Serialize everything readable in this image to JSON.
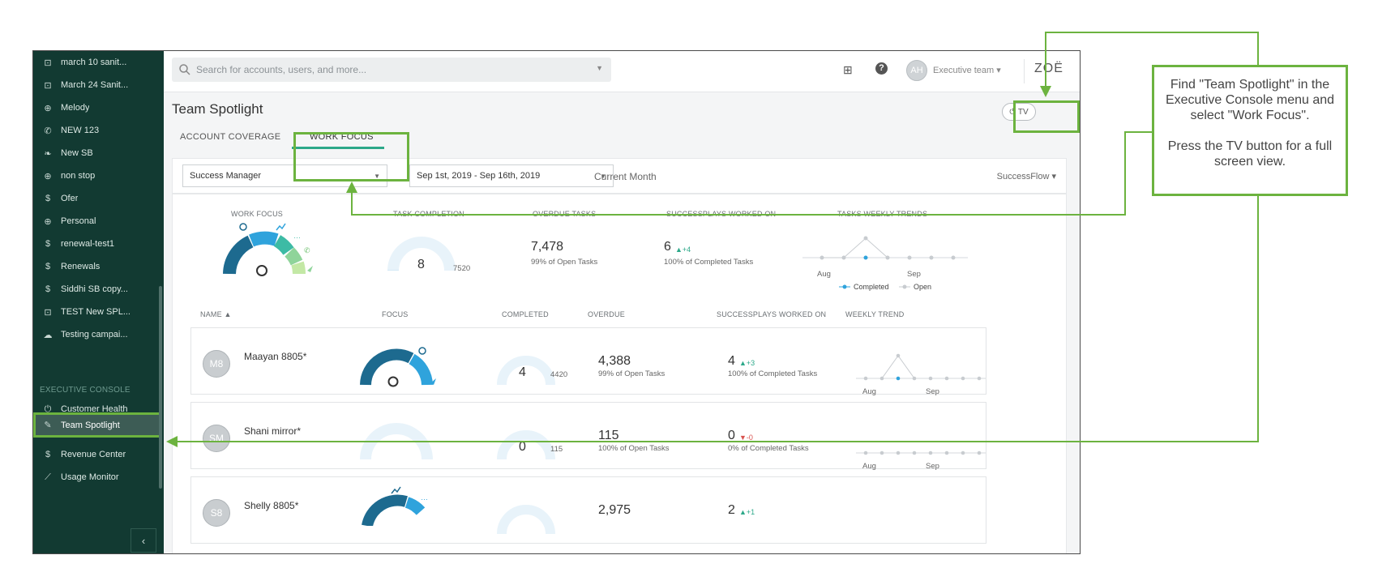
{
  "sidebar": {
    "items": [
      {
        "label": "march 10 sanit...",
        "icon": "shield-dollar-icon",
        "glyph": "⊡"
      },
      {
        "label": "March 24 Sanit...",
        "icon": "shield-dollar-icon",
        "glyph": "⊡"
      },
      {
        "label": "Melody",
        "icon": "lifebuoy-icon",
        "glyph": "⊕"
      },
      {
        "label": "NEW 123",
        "icon": "phone-icon",
        "glyph": "✆"
      },
      {
        "label": "New SB",
        "icon": "leaf-icon",
        "glyph": "❧"
      },
      {
        "label": "non stop",
        "icon": "lifebuoy-icon",
        "glyph": "⊕"
      },
      {
        "label": "Ofer",
        "icon": "dollar-icon",
        "glyph": "$"
      },
      {
        "label": "Personal",
        "icon": "lifebuoy-icon",
        "glyph": "⊕"
      },
      {
        "label": "renewal-test1",
        "icon": "dollar-icon",
        "glyph": "$"
      },
      {
        "label": "Renewals",
        "icon": "dollar-icon",
        "glyph": "$"
      },
      {
        "label": "Siddhi SB copy...",
        "icon": "dollar-icon",
        "glyph": "$"
      },
      {
        "label": "TEST New SPL...",
        "icon": "shield-dollar-icon",
        "glyph": "⊡"
      },
      {
        "label": "Testing campai...",
        "icon": "cloud-icon",
        "glyph": "☁"
      }
    ],
    "section_label": "EXECUTIVE CONSOLE",
    "console_items": [
      {
        "label": "Customer Health",
        "icon": "health-icon",
        "glyph": "⏻"
      },
      {
        "label": "Team Spotlight",
        "icon": "spotlight-icon",
        "glyph": "✎"
      },
      {
        "label": "Revenue Center",
        "icon": "revenue-icon",
        "glyph": "$"
      },
      {
        "label": "Usage Monitor",
        "icon": "chart-line-icon",
        "glyph": "⟋"
      }
    ],
    "collapse_glyph": "‹"
  },
  "topbar": {
    "search_placeholder": "Search for accounts, users, and more...",
    "help_glyph": "?",
    "gift_glyph": "⊞",
    "avatar_initials": "AH",
    "team_label": "Executive team ▾",
    "logo": "ZOË"
  },
  "page": {
    "title": "Team Spotlight",
    "tv_label": "⏻ TV",
    "tabs": [
      "ACCOUNT COVERAGE",
      "WORK FOCUS"
    ]
  },
  "filters": {
    "role": "Success Manager",
    "date_range": "Sep 1st, 2019 - Sep 16th, 2019",
    "period": "Current Month",
    "flow": "SuccessFlow ▾"
  },
  "summary": {
    "labels": [
      "WORK FOCUS",
      "TASK COMPLETION",
      "OVERDUE TASKS",
      "SUCCESSPLAYS WORKED ON",
      "TASKS WEEKLY TRENDS"
    ],
    "task_completion_value": "8",
    "task_completion_total": "7520",
    "task_completion_fraction": 0.001,
    "overdue_value": "7,478",
    "overdue_sub": "99% of Open Tasks",
    "plays_value": "6",
    "plays_delta": "▲+4",
    "plays_sub": "100% of Completed Tasks",
    "trend_axis": [
      "Aug",
      "Sep"
    ],
    "legend_completed": "Completed",
    "legend_open": "Open"
  },
  "columns": [
    "NAME ▲",
    "FOCUS",
    "COMPLETED",
    "OVERDUE",
    "SUCCESSPLAYS WORKED ON",
    "WEEKLY TREND"
  ],
  "rows": [
    {
      "initials": "M8",
      "name": "Maayan 8805*",
      "completed": "4",
      "completed_total": "4420",
      "overdue": "4,388",
      "overdue_sub": "99% of Open Tasks",
      "plays": "4",
      "plays_delta": "▲+3",
      "plays_dir": "up",
      "plays_sub": "100% of Completed Tasks"
    },
    {
      "initials": "SM",
      "name": "Shani mirror*",
      "completed": "0",
      "completed_total": "115",
      "overdue": "115",
      "overdue_sub": "100% of Open Tasks",
      "plays": "0",
      "plays_delta": "▼-0",
      "plays_dir": "down",
      "plays_sub": "0% of Completed Tasks"
    },
    {
      "initials": "S8",
      "name": "Shelly 8805*",
      "completed": "",
      "completed_total": "",
      "overdue": "2,975",
      "overdue_sub": "",
      "plays": "2",
      "plays_delta": "▲+1",
      "plays_dir": "up",
      "plays_sub": ""
    }
  ],
  "callout": {
    "line1": "Find \"Team Spotlight\" in the Executive Console menu and select \"Work Focus\".",
    "line2": "Press the TV button for a full screen view."
  },
  "colors": {
    "sidebar_bg": "#123a32",
    "accent": "#2ca889",
    "annotation": "#6cb33f",
    "focus_dark": "#1d6a8f",
    "focus_mid": "#2fa3dc"
  }
}
